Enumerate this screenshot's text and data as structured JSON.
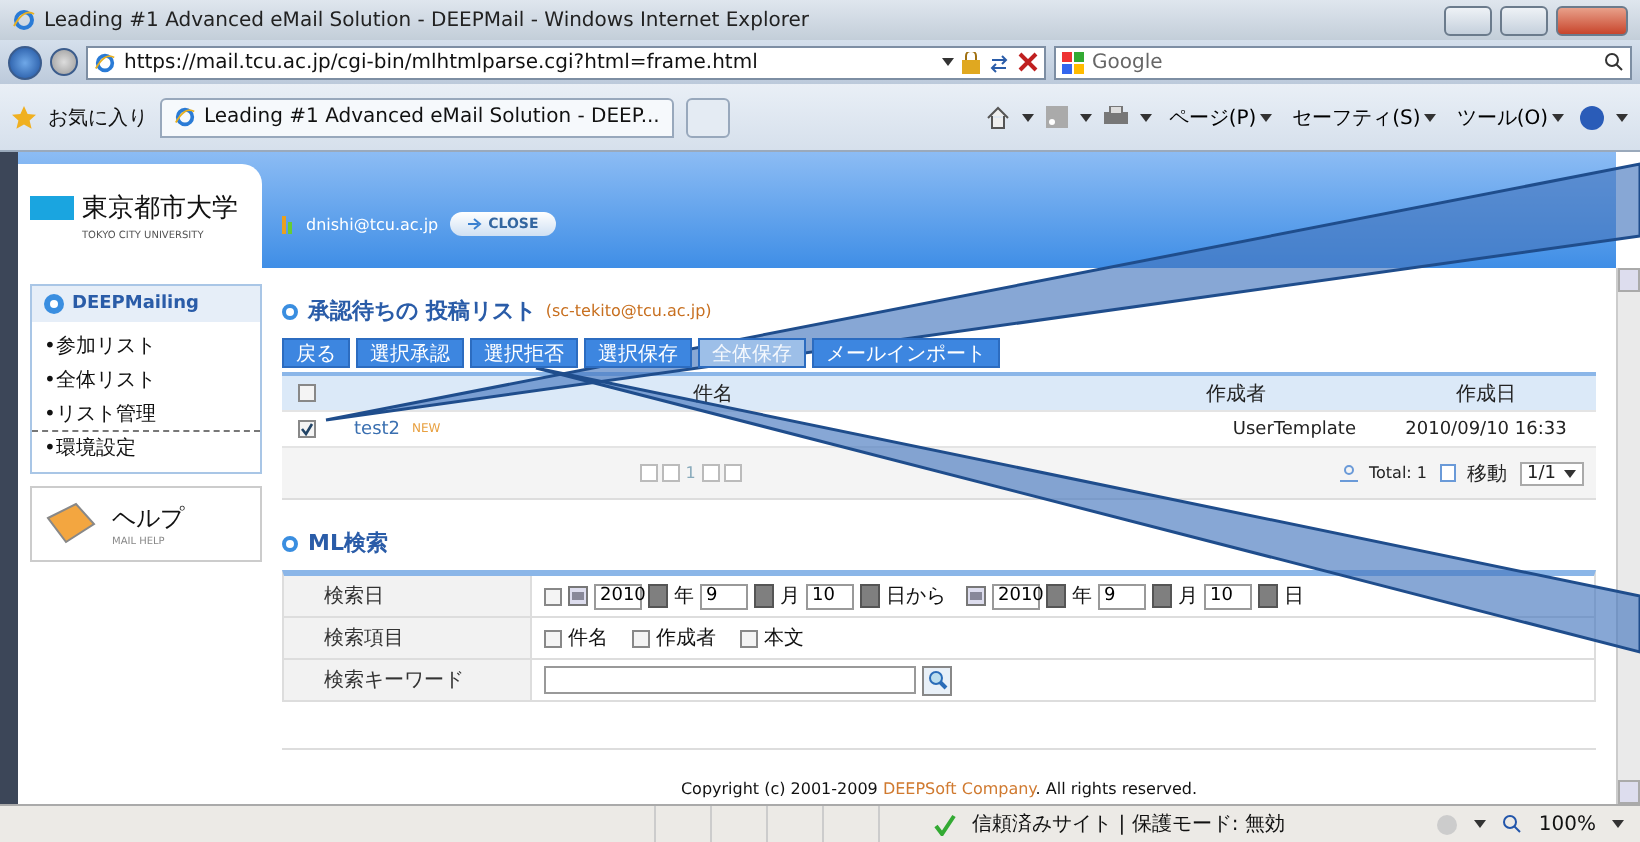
{
  "window": {
    "title": "Leading #1 Advanced eMail Solution - DEEPMail - Windows Internet Explorer"
  },
  "address_bar": {
    "url": "https://mail.tcu.ac.jp/cgi-bin/mlhtmlparse.cgi?html=frame.html",
    "search_placeholder": "Google"
  },
  "favorites_bar": {
    "favorites": "お気に入り",
    "tabs": [
      {
        "title": "Leading #1 Advanced eMail Solution - DEEP...",
        "selected": true
      }
    ],
    "commands": [
      "ページ(P)",
      "セーフティ(S)",
      "ツール(O)"
    ]
  },
  "header": {
    "logo_title": "東京都市大学",
    "logo_subtitle": "TOKYO CITY UNIVERSITY",
    "user": "dnishi@tcu.ac.jp",
    "close_button": "CLOSE"
  },
  "sidebar": {
    "title": "DEEPMailing",
    "items": [
      {
        "label": "•参加リスト",
        "divider_above": false
      },
      {
        "label": "•全体リスト",
        "divider_above": false
      },
      {
        "label": "•リスト管理",
        "divider_above": false
      },
      {
        "label": "•環境設定",
        "divider_above": true
      }
    ],
    "help": {
      "title": "ヘルプ",
      "subtitle": "MAIL HELP"
    }
  },
  "pending_list": {
    "title": "承認待ちの 投稿リスト",
    "address": "(sc-tekito@tcu.ac.jp)",
    "buttons": [
      {
        "label": "戻る",
        "disabled": false
      },
      {
        "label": "選択承認",
        "disabled": false
      },
      {
        "label": "選択拒否",
        "disabled": false
      },
      {
        "label": "選択保存",
        "disabled": false
      },
      {
        "label": "全体保存",
        "disabled": true
      },
      {
        "label": "メールインポート",
        "disabled": false
      }
    ],
    "columns": [
      "件名",
      "作成者",
      "作成日"
    ],
    "select_all_checked": false,
    "rows": [
      {
        "checked": true,
        "subject": "test2",
        "badge": "NEW",
        "author": "UserTemplate",
        "date": "2010/09/10 16:33"
      }
    ],
    "pager": {
      "page": "1",
      "total": "Total: 1",
      "move": "移動",
      "page_select": "1/1"
    }
  },
  "ml_search": {
    "title": "ML検索",
    "date_row": {
      "label": "検索日",
      "enabled": false,
      "from": {
        "year": "2010",
        "year_unit": "年",
        "month": "9",
        "month_unit": "月",
        "day": "10",
        "day_unit": "日から"
      },
      "to": {
        "year": "2010",
        "year_unit": "年",
        "month": "9",
        "month_unit": "月",
        "day": "10",
        "day_unit": "日"
      }
    },
    "fields_row": {
      "label": "検索項目",
      "options": [
        {
          "label": "件名",
          "checked": false
        },
        {
          "label": "作成者",
          "checked": false
        },
        {
          "label": "本文",
          "checked": false
        }
      ]
    },
    "keyword_row": {
      "label": "検索キーワード"
    }
  },
  "footer": {
    "copyright": "Copyright (c) 2001-2009 ",
    "company": "DEEPSoft Company",
    "rights": ". All rights reserved."
  },
  "status_bar": {
    "zone": "信頼済みサイト | 保護モード: 無効",
    "zoom": "100%"
  }
}
